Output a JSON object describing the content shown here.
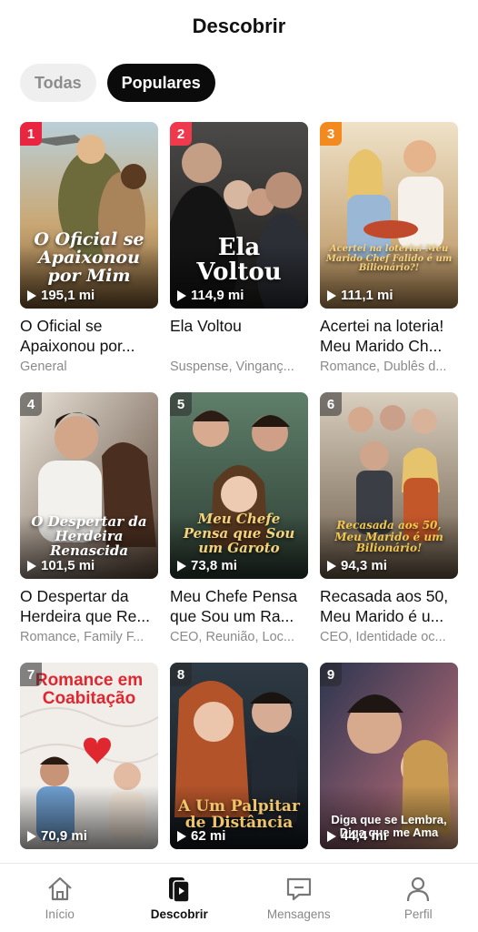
{
  "header": {
    "title": "Descobrir"
  },
  "tabs": [
    {
      "label": "Todas",
      "active": false
    },
    {
      "label": "Populares",
      "active": true
    }
  ],
  "cards": [
    {
      "rank": "1",
      "views": "195,1 mi",
      "title": "O Oficial se Apaixonou por...",
      "genre": "General",
      "poster_title": "O Oficial se Apaixonou por Mim"
    },
    {
      "rank": "2",
      "views": "114,9 mi",
      "title": "Ela Voltou",
      "genre": "Suspense, Vinganç...",
      "poster_title": "Ela Voltou"
    },
    {
      "rank": "3",
      "views": "111,1 mi",
      "title": "Acertei na loteria! Meu Marido Ch...",
      "genre": "Romance, Dublês d...",
      "poster_title": "Acertei na loteria! Meu Marido Chef Falido é um Bilionário?!"
    },
    {
      "rank": "4",
      "views": "101,5 mi",
      "title": "O Despertar da Herdeira que Re...",
      "genre": "Romance, Family F...",
      "poster_title": "O Despertar da Herdeira Renascida"
    },
    {
      "rank": "5",
      "views": "73,8 mi",
      "title": "Meu Chefe Pensa que Sou um Ra...",
      "genre": "CEO, Reunião, Loc...",
      "poster_title": "Meu Chefe Pensa que Sou um Garoto"
    },
    {
      "rank": "6",
      "views": "94,3 mi",
      "title": "Recasada aos 50, Meu Marido é u...",
      "genre": "CEO, Identidade oc...",
      "poster_title": "Recasada aos 50, Meu Marido é um Bilionário!"
    },
    {
      "rank": "7",
      "views": "70,9 mi",
      "title": "",
      "genre": "",
      "poster_title": "Romance em Coabitação"
    },
    {
      "rank": "8",
      "views": "62 mi",
      "title": "",
      "genre": "",
      "poster_title": "A Um Palpitar de Distância"
    },
    {
      "rank": "9",
      "views": "44,4 mi",
      "title": "",
      "genre": "",
      "poster_title": "Diga que se Lembra, Diga que me Ama"
    }
  ],
  "nav": [
    {
      "label": "Início",
      "icon": "home-icon",
      "active": false
    },
    {
      "label": "Descobrir",
      "icon": "discover-icon",
      "active": true
    },
    {
      "label": "Mensagens",
      "icon": "message-icon",
      "active": false
    },
    {
      "label": "Perfil",
      "icon": "profile-icon",
      "active": false
    }
  ],
  "colors": {
    "rank1": "#e8263f",
    "rank2": "#ef3a4d",
    "rank3": "#f38a1f",
    "active_tab": "#0b0b0b"
  }
}
